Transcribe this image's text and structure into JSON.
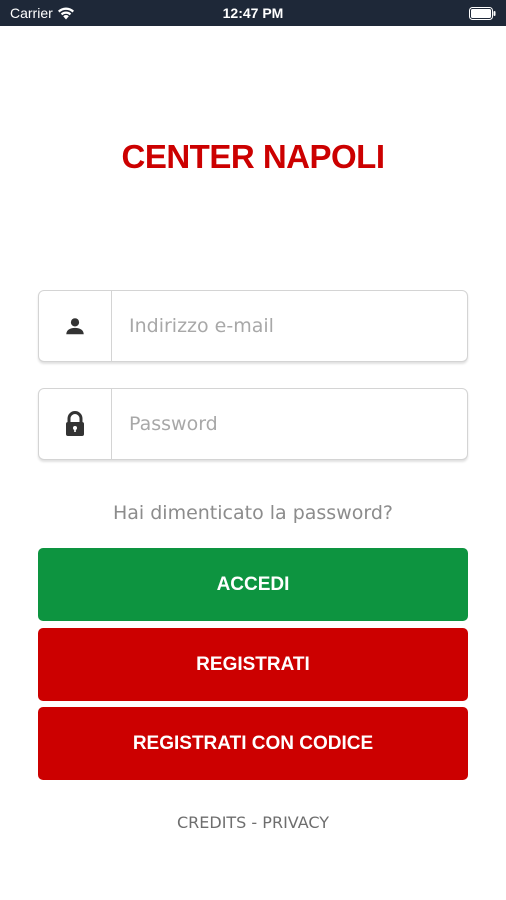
{
  "status_bar": {
    "carrier": "Carrier",
    "time": "12:47 PM"
  },
  "app": {
    "logo_text": "CENTER NAPOLI"
  },
  "login_form": {
    "email": {
      "placeholder": "Indirizzo e-mail",
      "value": "",
      "icon": "user-icon"
    },
    "password": {
      "placeholder": "Password",
      "value": "",
      "icon": "lock-icon"
    },
    "forgot_password": "Hai dimenticato la password?"
  },
  "buttons": {
    "login": "ACCEDI",
    "register": "REGISTRATI",
    "register_with_code": "REGISTRATI CON CODICE"
  },
  "footer": {
    "credits": "CREDITS",
    "separator": " - ",
    "privacy": "PRIVACY"
  },
  "colors": {
    "brand_red": "#cc0000",
    "login_green": "#0d9440",
    "status_bar_bg": "#1e2838"
  }
}
